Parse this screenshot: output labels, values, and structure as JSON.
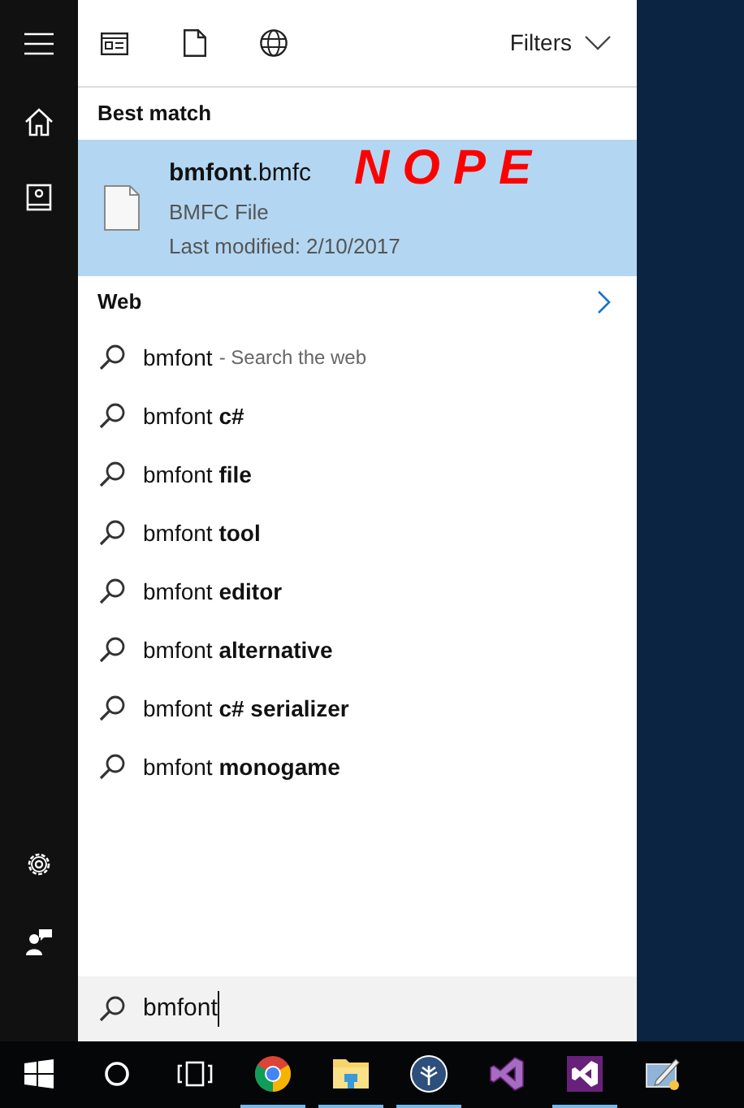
{
  "toolbar": {
    "filters_label": "Filters"
  },
  "best_match": {
    "heading": "Best match",
    "result": {
      "name": "**bmfont**.bmfc",
      "type": "BMFC File",
      "modified": "Last modified: 2/10/2017",
      "selected": true
    }
  },
  "annotation": {
    "text": "NOPE",
    "color": "#ff0000"
  },
  "web": {
    "heading": "Web",
    "suggestions": [
      {
        "text": "bmfont",
        "hint": "- Search the web"
      },
      {
        "text": "bmfont **c#**"
      },
      {
        "text": "bmfont **file**"
      },
      {
        "text": "bmfont **tool**"
      },
      {
        "text": "bmfont **editor**"
      },
      {
        "text": "bmfont **alternative**"
      },
      {
        "text": "bmfont **c# serializer**"
      },
      {
        "text": "bmfont **monogame**"
      }
    ]
  },
  "search_box": {
    "value": "bmfont"
  },
  "taskbar": [
    {
      "kind": "start",
      "running": false
    },
    {
      "kind": "cortana",
      "running": false
    },
    {
      "kind": "taskview",
      "running": false
    },
    {
      "kind": "chrome",
      "running": true
    },
    {
      "kind": "explorer",
      "running": true
    },
    {
      "kind": "tree",
      "running": true
    },
    {
      "kind": "vs-outline",
      "running": false
    },
    {
      "kind": "vs",
      "running": true
    },
    {
      "kind": "editor",
      "running": false
    }
  ]
}
